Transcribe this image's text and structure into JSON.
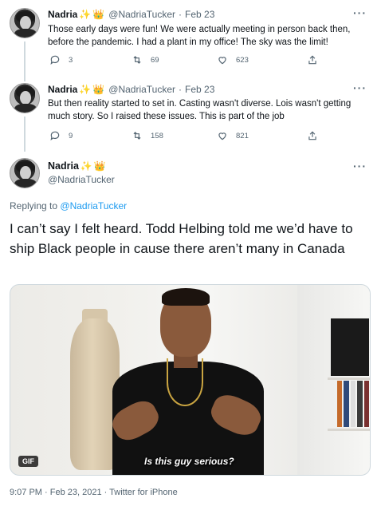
{
  "tweets": [
    {
      "name": "Nadria",
      "handle": "@NadriaTucker",
      "date": "Feb 23",
      "text": "Those early days were fun! We were actually meeting in person back then, before the pandemic. I had a plant in my office! The sky was the limit!",
      "reply_count": "3",
      "retweet_count": "69",
      "like_count": "623"
    },
    {
      "name": "Nadria",
      "handle": "@NadriaTucker",
      "date": "Feb 23",
      "text": "But then reality started to set in. Casting wasn't diverse. Lois wasn't getting much story. So I raised these issues. This is part of the job",
      "reply_count": "9",
      "retweet_count": "158",
      "like_count": "821"
    }
  ],
  "main": {
    "name": "Nadria",
    "handle": "@NadriaTucker",
    "replying_prefix": "Replying to",
    "replying_handle": "@NadriaTucker",
    "text": "I can’t say I felt heard. Todd Helbing told me we’d have to ship Black people in cause there aren’t many in Canada",
    "gif_badge": "GIF",
    "gif_caption": "Is this guy serious?",
    "timestamp": "9:07 PM · Feb 23, 2021 · Twitter for iPhone"
  },
  "glyphs": {
    "dot": "·",
    "more": "···",
    "sparkle": "✨",
    "crown": "👑"
  },
  "icons": [
    "reply-icon",
    "retweet-icon",
    "like-icon",
    "share-icon",
    "more-icon",
    "sparkle-icon",
    "crown-icon"
  ],
  "colors": {
    "text": "#0f1419",
    "secondary": "#536471",
    "link": "#1d9bf0",
    "border": "#cfd9de"
  }
}
